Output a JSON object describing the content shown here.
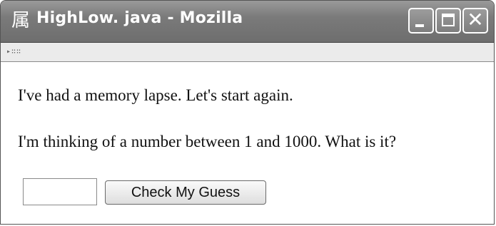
{
  "window": {
    "title": "HighLow. java - Mozilla",
    "app_icon": "mozilla-icon",
    "app_icon_glyph": "属",
    "controls": {
      "minimize": "minimize-icon",
      "maximize": "maximize-icon",
      "close": "close-icon",
      "close_glyph": "✕"
    }
  },
  "toolbar": {
    "grip_glyph": "▸∷∷"
  },
  "main": {
    "message": "I've had a memory lapse. Let's start again.",
    "prompt": "I'm thinking of a number between 1 and 1000. What is it?",
    "guess_input_value": "",
    "check_button_label": "Check My Guess"
  }
}
